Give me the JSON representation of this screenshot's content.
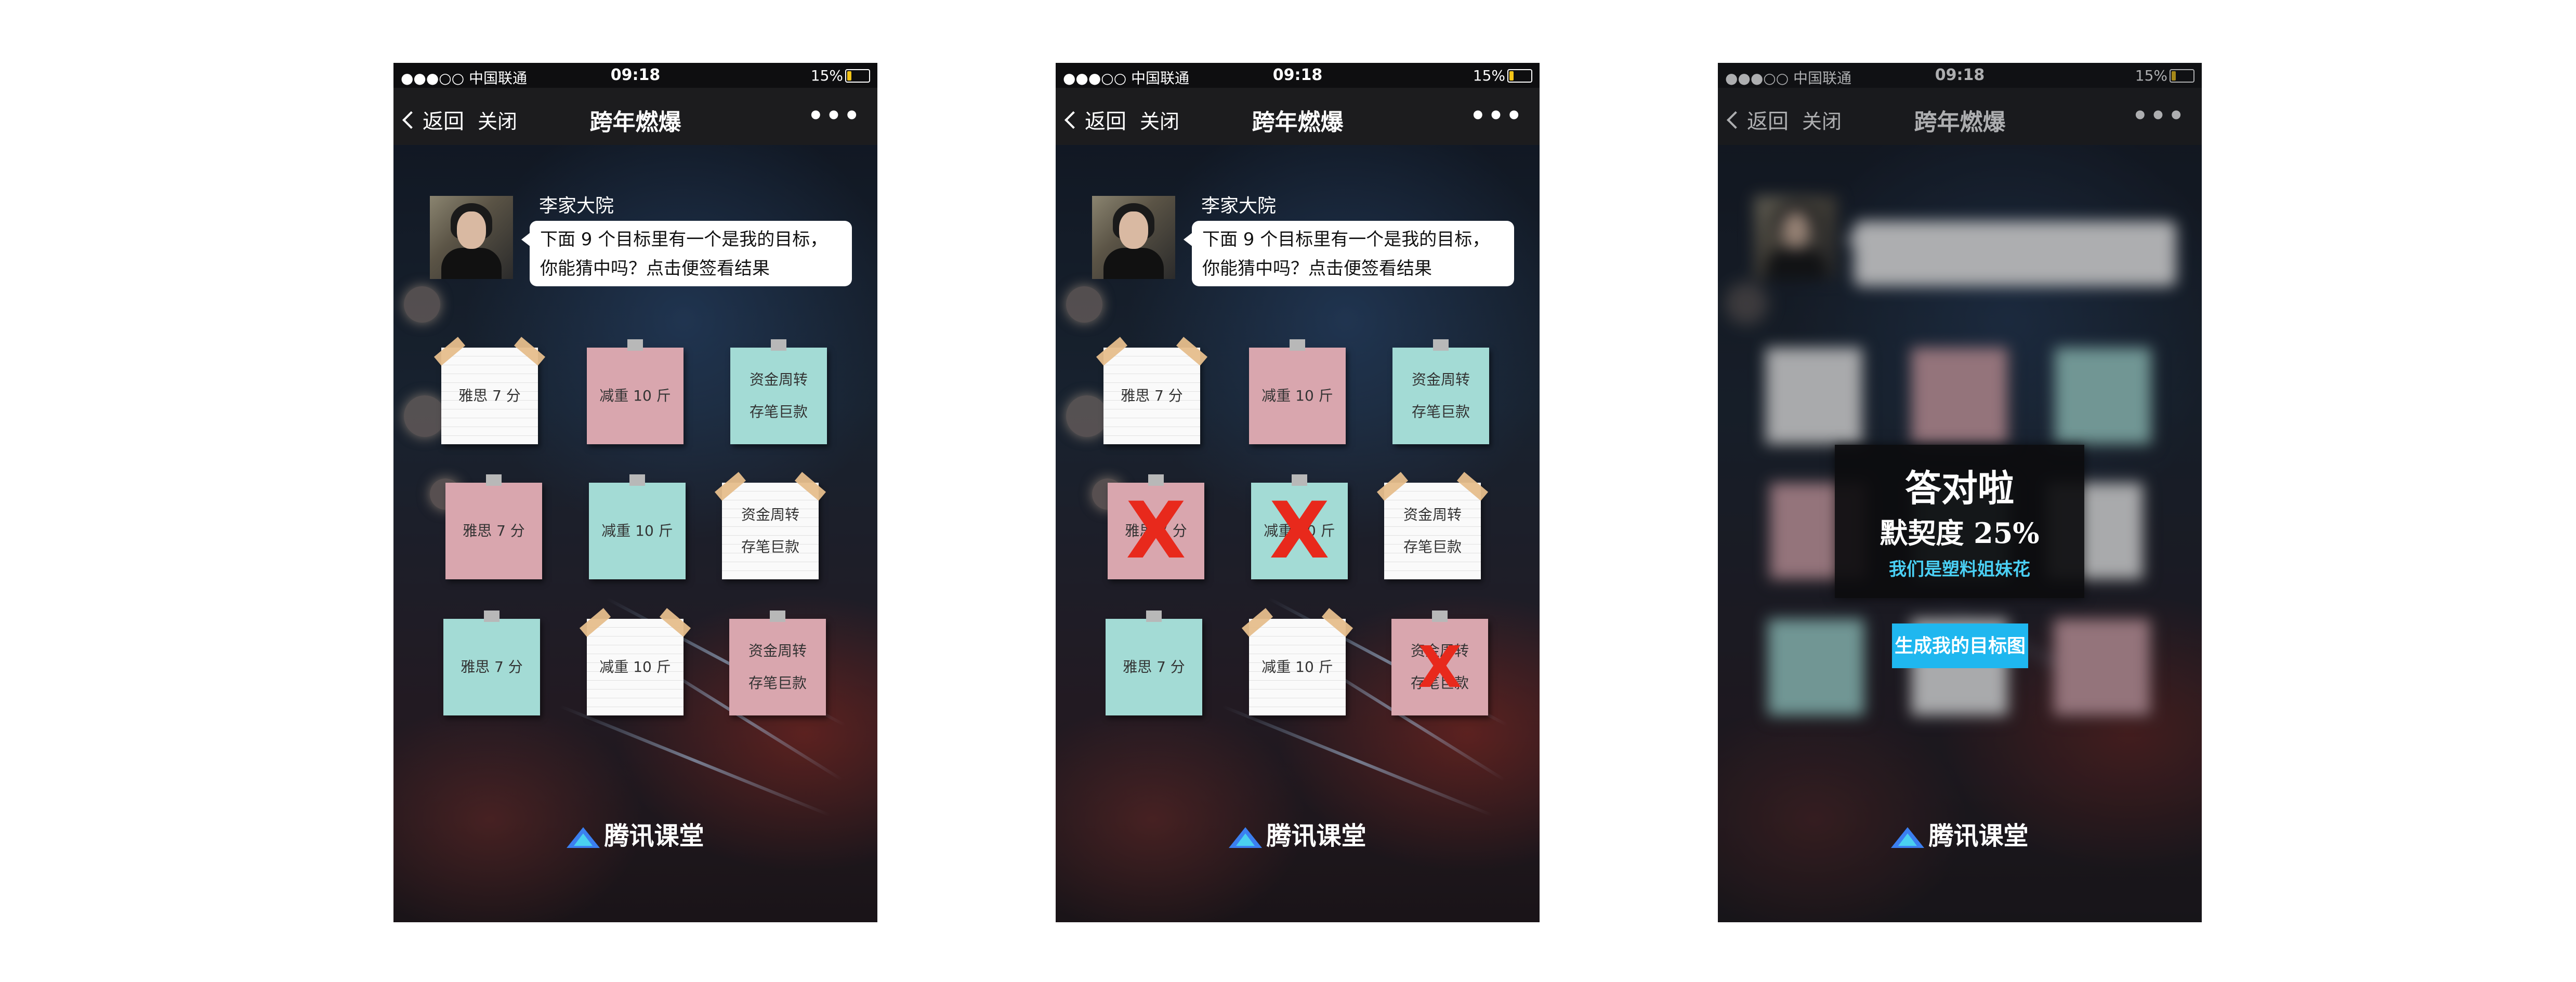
{
  "status_bar": {
    "carrier": "●●●○○ 中国联通",
    "time": "09:18",
    "battery": "15%"
  },
  "nav": {
    "back": "返回",
    "close": "关闭",
    "title": "跨年燃爆",
    "more": "•••"
  },
  "chat": {
    "sender": "李家大院",
    "line1": "下面 9 个目标里有一个是我的目标，",
    "line2": "你能猜中吗？点击便签看结果"
  },
  "notes": {
    "ielts": "雅思 7 分",
    "weight": "减重 10 斤",
    "money_1": "资金周转",
    "money_2": "存笔巨款"
  },
  "x_mark": "X",
  "brand": "腾讯课堂",
  "result": {
    "title": "答对啦",
    "score": "默契度 25%",
    "subtitle": "我们是塑料姐妹花",
    "button": "生成我的目标图"
  },
  "colors": {
    "pink_note": "#d9a6ae",
    "teal_note": "#a3dbd5",
    "accent": "#1fb7ef",
    "x_red": "#e8291c"
  }
}
